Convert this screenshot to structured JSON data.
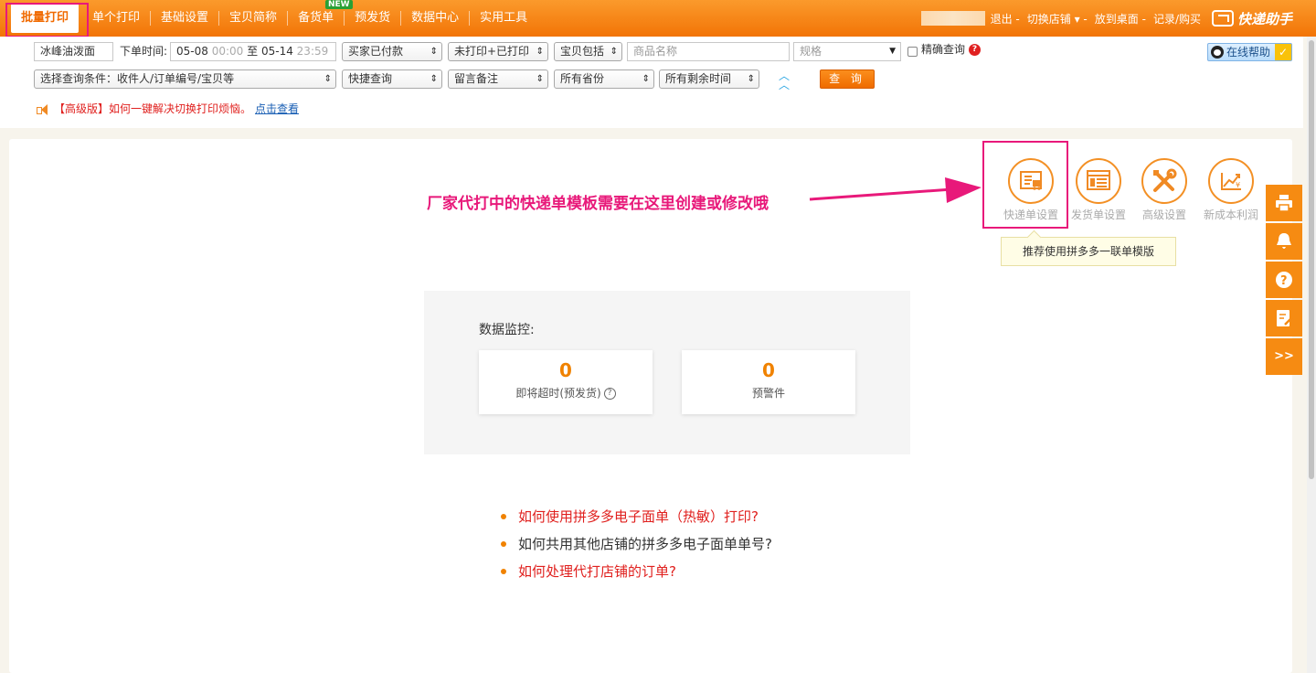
{
  "nav": {
    "items": [
      "批量打印",
      "单个打印",
      "基础设置",
      "宝贝简称",
      "备货单",
      "预发货",
      "数据中心",
      "实用工具"
    ],
    "new_badge": "NEW"
  },
  "account": {
    "logout": "退出",
    "switch_shop": "切换店铺",
    "desktop": "放到桌面",
    "records": "记录/购买",
    "brand": "快递助手"
  },
  "filters": {
    "shop": "冰峰油泼面",
    "order_time_label": "下单时间:",
    "start_date": "05-08",
    "start_time": "00:00",
    "to": "至",
    "end_date": "05-14",
    "end_time": "23:59",
    "pay_status": "买家已付款",
    "print_status": "未打印+已打印",
    "item_contains": "宝贝包括",
    "product_placeholder": "商品名称",
    "spec_placeholder": "规格",
    "exact_query": "精确查询",
    "query_condition": "选择查询条件：收件人/订单编号/宝贝等",
    "quick_query": "快捷查询",
    "remark": "留言备注",
    "province": "所有省份",
    "remaining_time": "所有剩余时间",
    "query_button": "查 询",
    "online_help": "在线帮助"
  },
  "notice": {
    "text": "【高级版】如何一键解决切换打印烦恼。",
    "link": "点击查看"
  },
  "tools": [
    {
      "label": "快递单设置",
      "icon": "express-template-icon"
    },
    {
      "label": "发货单设置",
      "icon": "delivery-note-icon"
    },
    {
      "label": "高级设置",
      "icon": "tools-icon"
    },
    {
      "label": "新成本利润",
      "icon": "profit-chart-icon"
    }
  ],
  "tooltip": "推荐使用拼多多一联单模版",
  "annotation": "厂家代打中的快递单模板需要在这里创建或修改哦",
  "monitor": {
    "title": "数据监控:",
    "cards": [
      {
        "value": "0",
        "label": "即将超时(预发货)"
      },
      {
        "value": "0",
        "label": "预警件"
      }
    ]
  },
  "faq": [
    "如何使用拼多多电子面单（热敏）打印?",
    "如何共用其他店铺的拼多多电子面单单号?",
    "如何处理代打店铺的订单?"
  ],
  "floatbar": {
    "expand": ">>"
  },
  "colors": {
    "accent": "#f27406",
    "highlight": "#e8197a",
    "link": "#1a5fb4"
  }
}
